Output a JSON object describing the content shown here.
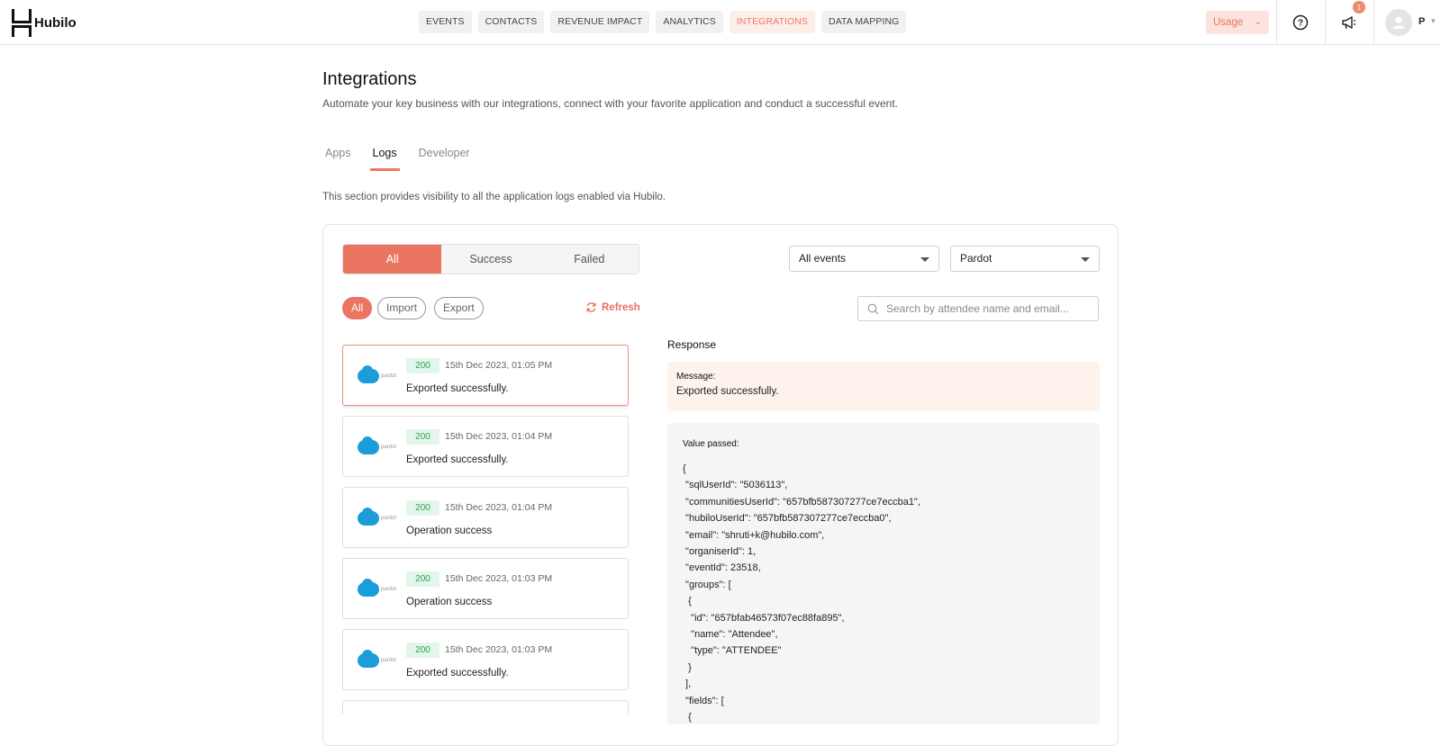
{
  "brand": {
    "name": "Hubilo"
  },
  "nav": [
    {
      "label": "EVENTS"
    },
    {
      "label": "CONTACTS"
    },
    {
      "label": "REVENUE IMPACT"
    },
    {
      "label": "ANALYTICS"
    },
    {
      "label": "INTEGRATIONS",
      "active": true
    },
    {
      "label": "DATA MAPPING"
    }
  ],
  "header": {
    "usage_label": "Usage",
    "notification_count": "1",
    "user_initial": "P"
  },
  "page": {
    "title": "Integrations",
    "subtitle": "Automate your key business with our integrations, connect with your favorite application and conduct a successful event.",
    "tabs": [
      {
        "label": "Apps"
      },
      {
        "label": "Logs",
        "active": true
      },
      {
        "label": "Developer"
      }
    ],
    "section_description": "This section provides visibility to all the application logs enabled via Hubilo."
  },
  "filters": {
    "status_segments": [
      {
        "label": "All",
        "active": true
      },
      {
        "label": "Success"
      },
      {
        "label": "Failed"
      }
    ],
    "event_dropdown": "All events",
    "app_dropdown": "Pardot",
    "type_chips": [
      {
        "label": "All",
        "active": true
      },
      {
        "label": "Import"
      },
      {
        "label": "Export"
      }
    ],
    "refresh_label": "Refresh",
    "search_placeholder": "Search by attendee name and email..."
  },
  "logs": [
    {
      "code": "200",
      "time": "15th Dec 2023, 01:05 PM",
      "message": "Exported successfully.",
      "selected": true
    },
    {
      "code": "200",
      "time": "15th Dec 2023, 01:04 PM",
      "message": "Exported successfully."
    },
    {
      "code": "200",
      "time": "15th Dec 2023, 01:04 PM",
      "message": "Operation success"
    },
    {
      "code": "200",
      "time": "15th Dec 2023, 01:03 PM",
      "message": "Operation success"
    },
    {
      "code": "200",
      "time": "15th Dec 2023, 01:03 PM",
      "message": "Exported successfully."
    }
  ],
  "log_app_label": "pardot",
  "response": {
    "title": "Response",
    "message_label": "Message:",
    "message_value": "Exported successfully.",
    "value_label": "Value passed:",
    "json_lines": [
      "{",
      " \"sqlUserId\": \"5036113\",",
      " \"communitiesUserId\": \"657bfb587307277ce7eccba1\",",
      " \"hubiloUserId\": \"657bfb587307277ce7eccba0\",",
      " \"email\": \"shruti+k@hubilo.com\",",
      " \"organiserId\": 1,",
      " \"eventId\": 23518,",
      " \"groups\": [",
      "  {",
      "   \"id\": \"657bfab46573f07ec88fa895\",",
      "   \"name\": \"Attendee\",",
      "   \"type\": \"ATTENDEE\"",
      "  }",
      " ],",
      " \"fields\": [",
      "  {"
    ]
  }
}
